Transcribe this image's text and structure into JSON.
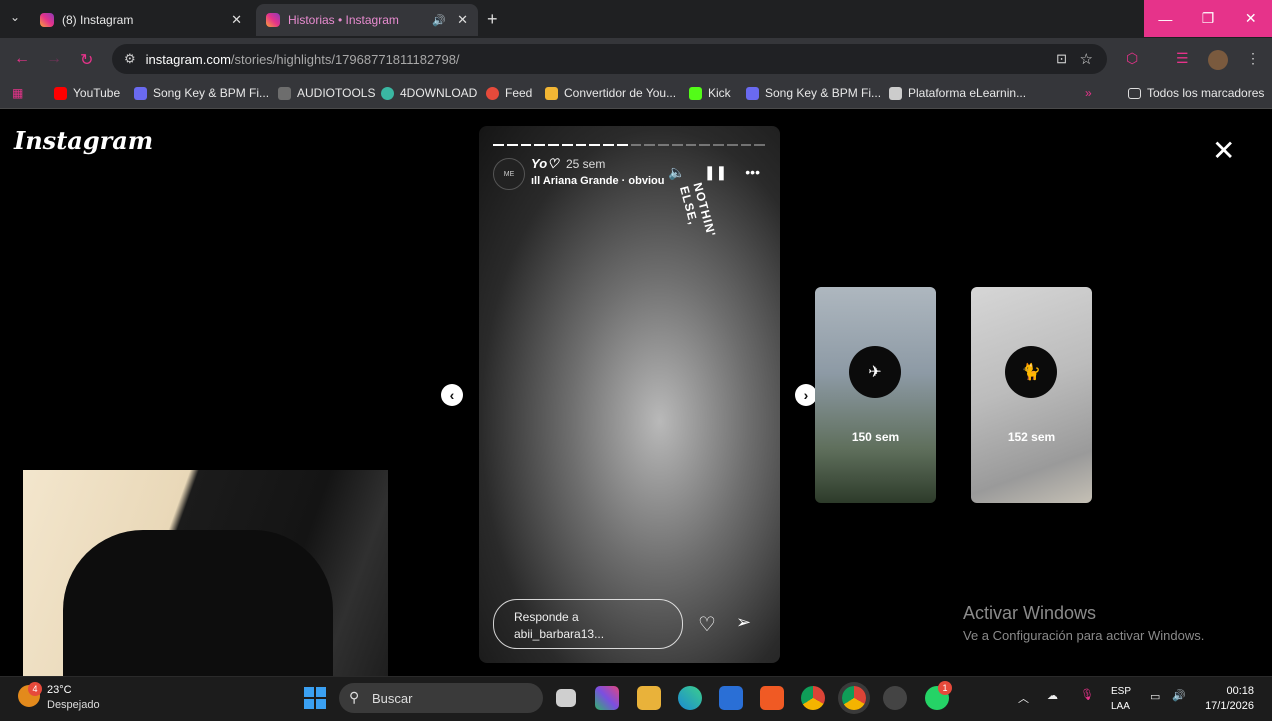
{
  "browser": {
    "tabs": [
      {
        "title": "(8) Instagram",
        "active": false
      },
      {
        "title": "Historias • Instagram",
        "active": true
      }
    ],
    "url_host": "instagram.com",
    "url_path": "/stories/highlights/17968771811182798/",
    "bookmarks": [
      {
        "label": "YouTube",
        "icon": "youtube-icon",
        "color": "#ff0000"
      },
      {
        "label": "Song Key & BPM Fi...",
        "icon": "songkey-icon",
        "color": "#6a6af0"
      },
      {
        "label": "AUDIOTOOLS",
        "icon": "audiotools-icon",
        "color": "#6d6d6d"
      },
      {
        "label": "4DOWNLOAD",
        "icon": "download-icon",
        "color": "#3ab7a2"
      },
      {
        "label": "Feed",
        "icon": "feed-icon",
        "color": "#e64a3b"
      },
      {
        "label": "Convertidor de You...",
        "icon": "converter-icon",
        "color": "#f2b634"
      },
      {
        "label": "Kick",
        "icon": "kick-icon",
        "color": "#53fc18"
      },
      {
        "label": "Song Key & BPM Fi...",
        "icon": "songkey-icon",
        "color": "#6a6af0"
      },
      {
        "label": "Plataforma eLearnin...",
        "icon": "elearning-icon",
        "color": "#cccccc"
      }
    ],
    "all_bookmarks_label": "Todos los marcadores"
  },
  "instagram": {
    "logo": "Instagram",
    "story": {
      "username": "Yo♡",
      "time": "25 sem",
      "song": "Ariana Grande · obviou",
      "sticker_text": "NOTHIN' ELSE,",
      "reply_line1": "Responde a",
      "reply_line2": "abii_barbara13...",
      "progress_total": 20,
      "progress_done": 10
    },
    "next_highlights": [
      {
        "label": "150 sem"
      },
      {
        "label": "152 sem"
      }
    ]
  },
  "windows_watermark": {
    "title": "Activar Windows",
    "subtitle": "Ve a Configuración para activar Windows."
  },
  "taskbar": {
    "weather_temp": "23°C",
    "weather_desc": "Despejado",
    "weather_badge": "4",
    "search_label": "Buscar",
    "lang_line1": "ESP",
    "lang_line2": "LAA",
    "time": "00:18",
    "date": "17/1/2026",
    "whatsapp_badge": "1"
  },
  "colors": {
    "accent": "#e6338a",
    "tab_bg": "#1f2022",
    "toolbar_bg": "#35363a"
  }
}
